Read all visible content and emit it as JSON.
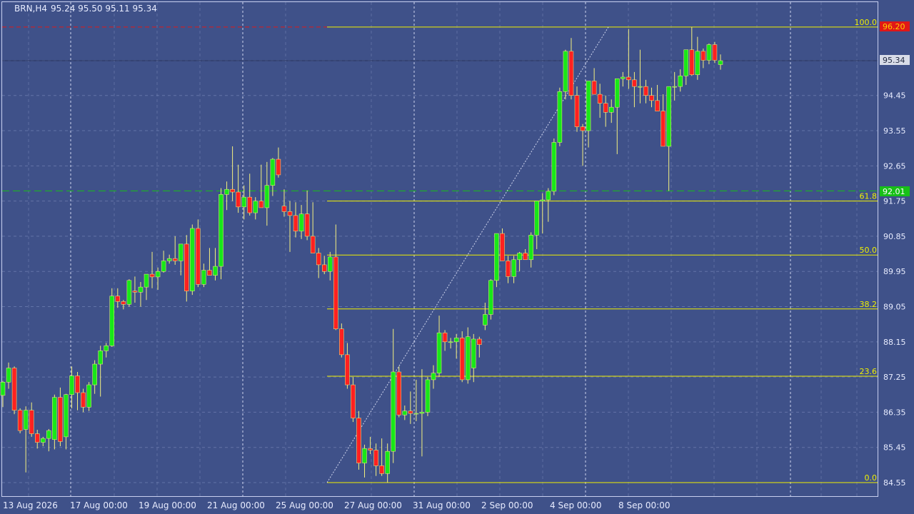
{
  "header": {
    "symbol_timeframe": "BRN,H4",
    "ohlc": "95.24 95.50 95.11 95.34"
  },
  "colors": {
    "background": "#3f5189",
    "bull": "#18e818",
    "bear": "#ff2020",
    "fib": "#f0f000",
    "grid": "#8090c0",
    "level_red": "#e01818",
    "level_green": "#18c018",
    "text": "#e8ecff"
  },
  "chart_data": {
    "type": "candlestick",
    "symbol": "BRN",
    "timeframe": "H4",
    "grid": true,
    "y_ticks": [
      "95.34",
      "94.45",
      "93.55",
      "92.65",
      "91.75",
      "90.85",
      "89.95",
      "89.05",
      "88.15",
      "87.25",
      "86.35",
      "85.45",
      "84.55"
    ],
    "ylim": [
      84.45,
      96.5
    ],
    "x_labels": [
      "13 Aug 2026",
      "17 Aug 00:00",
      "19 Aug 00:00",
      "21 Aug 00:00",
      "25 Aug 00:00",
      "27 Aug 00:00",
      "31 Aug 00:00",
      "2 Sep 00:00",
      "4 Sep 00:00",
      "8 Sep 00:00"
    ],
    "price_labels": {
      "current": "95.34",
      "high_level": "96.20",
      "support_level": "92.01"
    },
    "levels": {
      "red_dashed": 96.2,
      "green_dashed": 92.01,
      "last_price": 95.34
    },
    "fibonacci": {
      "high": 96.2,
      "low": 84.55,
      "levels": [
        {
          "label": "100.0",
          "price": 96.2
        },
        {
          "label": "61.8",
          "price": 91.75
        },
        {
          "label": "50.0",
          "price": 90.37
        },
        {
          "label": "38.2",
          "price": 88.99
        },
        {
          "label": "23.6",
          "price": 87.27
        },
        {
          "label": "0.0",
          "price": 84.55
        }
      ]
    },
    "candles": [
      [
        86.78,
        87.15,
        86.48,
        87.12
      ],
      [
        87.12,
        87.62,
        86.95,
        87.48
      ],
      [
        87.48,
        87.52,
        86.3,
        86.4
      ],
      [
        86.4,
        86.45,
        85.81,
        85.88
      ],
      [
        85.91,
        86.5,
        84.81,
        86.4
      ],
      [
        86.4,
        86.6,
        85.72,
        85.8
      ],
      [
        85.8,
        85.9,
        85.42,
        85.58
      ],
      [
        85.58,
        85.72,
        85.48,
        85.68
      ],
      [
        85.68,
        85.92,
        85.35,
        85.88
      ],
      [
        85.65,
        86.8,
        85.4,
        86.73
      ],
      [
        86.73,
        86.98,
        85.48,
        85.6
      ],
      [
        85.72,
        86.82,
        85.4,
        86.8
      ],
      [
        86.8,
        87.52,
        86.45,
        87.28
      ],
      [
        87.28,
        87.38,
        86.4,
        86.85
      ],
      [
        86.85,
        86.95,
        86.35,
        86.48
      ],
      [
        86.48,
        87.12,
        86.38,
        87.05
      ],
      [
        87.05,
        87.68,
        86.82,
        87.58
      ],
      [
        87.58,
        88.05,
        86.75,
        87.92
      ],
      [
        87.92,
        88.12,
        87.75,
        88.05
      ],
      [
        88.05,
        89.52,
        88.02,
        89.32
      ],
      [
        89.32,
        89.52,
        89.02,
        89.18
      ],
      [
        89.18,
        89.22,
        88.98,
        89.11
      ],
      [
        89.11,
        89.75,
        89.05,
        89.72
      ],
      [
        89.45,
        89.82,
        89.15,
        89.42
      ],
      [
        89.42,
        89.68,
        89.05,
        89.55
      ],
      [
        89.55,
        89.88,
        89.22,
        89.88
      ],
      [
        89.88,
        90.45,
        89.52,
        89.81
      ],
      [
        89.81,
        90.05,
        89.48,
        89.95
      ],
      [
        89.95,
        90.48,
        89.92,
        90.22
      ],
      [
        90.22,
        90.38,
        90.15,
        90.28
      ],
      [
        90.28,
        90.85,
        90.12,
        90.22
      ],
      [
        90.22,
        90.55,
        89.85,
        90.65
      ],
      [
        90.65,
        90.88,
        89.18,
        89.45
      ],
      [
        89.45,
        91.15,
        89.35,
        91.05
      ],
      [
        91.05,
        91.28,
        89.55,
        89.62
      ],
      [
        89.62,
        90.15,
        89.55,
        89.98
      ],
      [
        89.98,
        90.55,
        89.88,
        89.85
      ],
      [
        89.85,
        90.55,
        89.72,
        90.08
      ],
      [
        90.08,
        92.08,
        89.75,
        91.92
      ],
      [
        91.92,
        92.25,
        91.52,
        92.05
      ],
      [
        92.05,
        93.15,
        91.75,
        91.98
      ],
      [
        91.98,
        92.68,
        91.45,
        91.6
      ],
      [
        91.6,
        92.15,
        91.28,
        91.85
      ],
      [
        91.85,
        92.45,
        91.38,
        91.45
      ],
      [
        91.45,
        91.85,
        91.28,
        91.75
      ],
      [
        91.75,
        92.68,
        91.58,
        91.58
      ],
      [
        91.58,
        92.75,
        91.12,
        92.15
      ],
      [
        92.15,
        92.85,
        91.88,
        92.82
      ],
      [
        92.82,
        93.12,
        92.35,
        92.42
      ],
      [
        91.62,
        92.05,
        91.35,
        91.48
      ],
      [
        91.48,
        91.75,
        90.45,
        91.38
      ],
      [
        91.38,
        91.72,
        90.82,
        90.98
      ],
      [
        90.98,
        91.65,
        90.78,
        91.42
      ],
      [
        91.42,
        92.02,
        90.75,
        90.85
      ],
      [
        90.85,
        91.72,
        90.68,
        90.42
      ],
      [
        90.42,
        90.55,
        89.78,
        90.12
      ],
      [
        90.12,
        90.35,
        89.88,
        89.95
      ],
      [
        89.95,
        90.45,
        89.72,
        90.32
      ],
      [
        90.32,
        91.15,
        88.45,
        88.48
      ],
      [
        88.48,
        88.62,
        87.75,
        87.82
      ],
      [
        87.82,
        88.12,
        86.95,
        87.05
      ],
      [
        87.05,
        87.25,
        86.1,
        86.2
      ],
      [
        86.2,
        86.38,
        84.88,
        85.05
      ],
      [
        85.05,
        85.52,
        84.68,
        85.42
      ],
      [
        85.42,
        85.72,
        85.28,
        85.38
      ],
      [
        85.38,
        85.55,
        84.72,
        84.98
      ],
      [
        84.98,
        85.68,
        84.72,
        84.78
      ],
      [
        84.78,
        85.55,
        84.55,
        85.35
      ],
      [
        85.35,
        88.48,
        85.05,
        87.38
      ],
      [
        87.38,
        87.52,
        86.22,
        86.28
      ],
      [
        86.28,
        86.52,
        86.15,
        86.38
      ],
      [
        86.38,
        86.88,
        86.05,
        86.32
      ],
      [
        86.32,
        87.18,
        86.12,
        86.32
      ],
      [
        86.32,
        87.45,
        85.22,
        86.35
      ],
      [
        86.35,
        87.25,
        86.25,
        87.18
      ],
      [
        87.18,
        87.55,
        86.95,
        87.35
      ],
      [
        87.35,
        88.82,
        87.25,
        88.38
      ],
      [
        88.38,
        88.45,
        87.92,
        88.15
      ],
      [
        88.15,
        88.25,
        87.98,
        88.15
      ],
      [
        88.15,
        88.35,
        87.72,
        88.25
      ],
      [
        88.25,
        88.42,
        87.12,
        87.18
      ],
      [
        87.18,
        88.52,
        87.08,
        88.28
      ],
      [
        87.48,
        88.35,
        87.12,
        88.22
      ],
      [
        88.22,
        88.28,
        87.75,
        88.08
      ],
      [
        88.58,
        89.15,
        88.45,
        88.85
      ],
      [
        88.85,
        89.75,
        88.72,
        89.72
      ],
      [
        89.72,
        90.62,
        89.55,
        90.92
      ],
      [
        90.92,
        91.05,
        90.25,
        90.22
      ],
      [
        90.22,
        90.35,
        89.65,
        89.82
      ],
      [
        89.82,
        90.35,
        89.65,
        90.25
      ],
      [
        90.25,
        90.45,
        89.95,
        90.42
      ],
      [
        90.42,
        90.52,
        90.25,
        90.25
      ],
      [
        90.25,
        90.95,
        90.05,
        90.88
      ],
      [
        90.88,
        91.75,
        90.52,
        91.75
      ],
      [
        91.75,
        91.95,
        90.92,
        91.78
      ],
      [
        91.78,
        92.08,
        91.22,
        92.0
      ],
      [
        92.0,
        93.35,
        91.9,
        93.25
      ],
      [
        93.25,
        94.65,
        93.15,
        94.55
      ],
      [
        94.55,
        95.62,
        94.35,
        95.58
      ],
      [
        95.58,
        95.92,
        94.35,
        94.45
      ],
      [
        94.45,
        94.68,
        93.52,
        93.65
      ],
      [
        93.65,
        93.72,
        92.65,
        93.55
      ],
      [
        93.55,
        94.82,
        93.12,
        94.82
      ],
      [
        94.82,
        95.15,
        94.55,
        94.48
      ],
      [
        94.48,
        94.75,
        93.88,
        94.25
      ],
      [
        94.25,
        94.45,
        93.65,
        94.02
      ],
      [
        94.02,
        94.35,
        93.75,
        94.15
      ],
      [
        94.15,
        94.62,
        92.95,
        94.88
      ],
      [
        94.88,
        95.05,
        94.68,
        94.92
      ],
      [
        94.92,
        96.15,
        94.62,
        94.85
      ],
      [
        94.85,
        95.05,
        94.15,
        94.68
      ],
      [
        94.68,
        95.62,
        94.25,
        94.68
      ],
      [
        94.68,
        94.85,
        94.25,
        94.45
      ],
      [
        94.45,
        94.65,
        94.15,
        94.32
      ],
      [
        94.32,
        94.72,
        94.08,
        94.05
      ],
      [
        94.05,
        94.48,
        93.65,
        93.15
      ],
      [
        93.15,
        94.58,
        92.01,
        94.68
      ],
      [
        94.68,
        95.05,
        94.32,
        94.68
      ],
      [
        94.68,
        95.12,
        94.55,
        94.95
      ],
      [
        94.95,
        95.52,
        94.72,
        95.62
      ],
      [
        95.62,
        96.2,
        94.95,
        94.98
      ],
      [
        94.98,
        95.95,
        94.85,
        95.58
      ],
      [
        95.58,
        95.65,
        95.15,
        95.35
      ],
      [
        95.35,
        95.78,
        95.25,
        95.75
      ],
      [
        95.75,
        95.82,
        95.28,
        95.35
      ],
      [
        95.24,
        95.5,
        95.11,
        95.34
      ]
    ]
  }
}
